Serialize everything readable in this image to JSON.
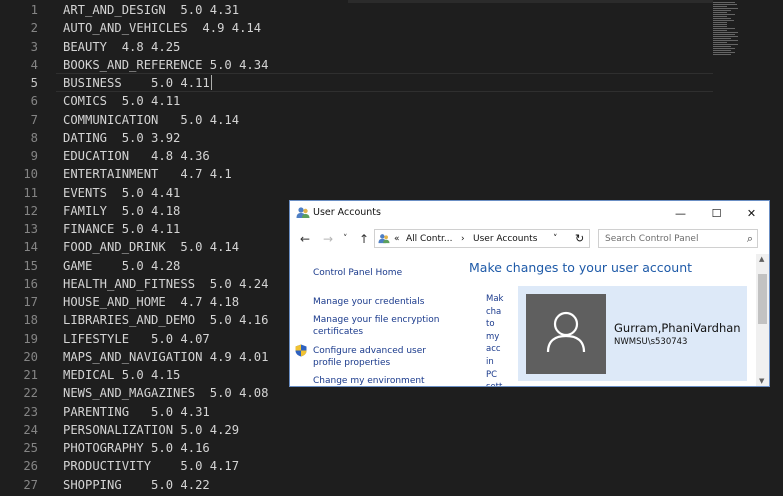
{
  "editor": {
    "lines": [
      {
        "num": "1",
        "text": "ART_AND_DESIGN  5.0 4.31"
      },
      {
        "num": "2",
        "text": "AUTO_AND_VEHICLES  4.9 4.14"
      },
      {
        "num": "3",
        "text": "BEAUTY  4.8 4.25"
      },
      {
        "num": "4",
        "text": "BOOKS_AND_REFERENCE 5.0 4.34"
      },
      {
        "num": "5",
        "text": "BUSINESS    5.0 4.11"
      },
      {
        "num": "6",
        "text": "COMICS  5.0 4.11"
      },
      {
        "num": "7",
        "text": "COMMUNICATION   5.0 4.14"
      },
      {
        "num": "8",
        "text": "DATING  5.0 3.92"
      },
      {
        "num": "9",
        "text": "EDUCATION   4.8 4.36"
      },
      {
        "num": "10",
        "text": "ENTERTAINMENT   4.7 4.1"
      },
      {
        "num": "11",
        "text": "EVENTS  5.0 4.41"
      },
      {
        "num": "12",
        "text": "FAMILY  5.0 4.18"
      },
      {
        "num": "13",
        "text": "FINANCE 5.0 4.11"
      },
      {
        "num": "14",
        "text": "FOOD_AND_DRINK  5.0 4.14"
      },
      {
        "num": "15",
        "text": "GAME    5.0 4.28"
      },
      {
        "num": "16",
        "text": "HEALTH_AND_FITNESS  5.0 4.24"
      },
      {
        "num": "17",
        "text": "HOUSE_AND_HOME  4.7 4.18"
      },
      {
        "num": "18",
        "text": "LIBRARIES_AND_DEMO  5.0 4.16"
      },
      {
        "num": "19",
        "text": "LIFESTYLE   5.0 4.07"
      },
      {
        "num": "20",
        "text": "MAPS_AND_NAVIGATION 4.9 4.01"
      },
      {
        "num": "21",
        "text": "MEDICAL 5.0 4.15"
      },
      {
        "num": "22",
        "text": "NEWS_AND_MAGAZINES  5.0 4.08"
      },
      {
        "num": "23",
        "text": "PARENTING   5.0 4.31"
      },
      {
        "num": "24",
        "text": "PERSONALIZATION 5.0 4.29"
      },
      {
        "num": "25",
        "text": "PHOTOGRAPHY 5.0 4.16"
      },
      {
        "num": "26",
        "text": "PRODUCTIVITY    5.0 4.17"
      },
      {
        "num": "27",
        "text": "SHOPPING    5.0 4.22"
      }
    ],
    "current_line": "5"
  },
  "user_accounts": {
    "title": "User Accounts",
    "nav": {
      "back": "←",
      "forward": "→",
      "recent": "˅",
      "up": "↑"
    },
    "address": {
      "prefix": "«",
      "crumb1": "All Contr...",
      "sep1": "›",
      "crumb2": "User Accounts",
      "dropdown": "˅",
      "refresh": "↻"
    },
    "search": {
      "placeholder": "Search Control Panel"
    },
    "left_panel": {
      "home": "Control Panel Home",
      "credentials": "Manage your credentials",
      "encryption_1": "Manage your file encryption",
      "encryption_2": "certificates",
      "advanced_1": "Configure advanced user",
      "advanced_2": "profile properties",
      "environment": "Change my environment"
    },
    "main": {
      "title": "Make changes to your user account",
      "narrow_links": [
        "Mak",
        "cha",
        "to",
        "my",
        "acc",
        "in",
        "PC",
        "sett"
      ]
    },
    "user": {
      "name": "Gurram,PhaniVardhan",
      "id": "NWMSU\\s530743"
    },
    "window_buttons": {
      "minimize": "—",
      "maximize": "☐",
      "close": "✕"
    }
  },
  "icons": {
    "app": "user-accounts-icon",
    "avatar": "person-silhouette-icon",
    "search": "magnifier-icon",
    "shield": "uac-shield-icon"
  },
  "colors": {
    "editor_bg": "#1e1e1e",
    "editor_text": "#d4d4d4",
    "line_number": "#858585",
    "link": "#1a3a8c",
    "heading": "#1e5aa8",
    "user_card_bg": "#dde9f8",
    "avatar_bg": "#5f5f5f"
  }
}
